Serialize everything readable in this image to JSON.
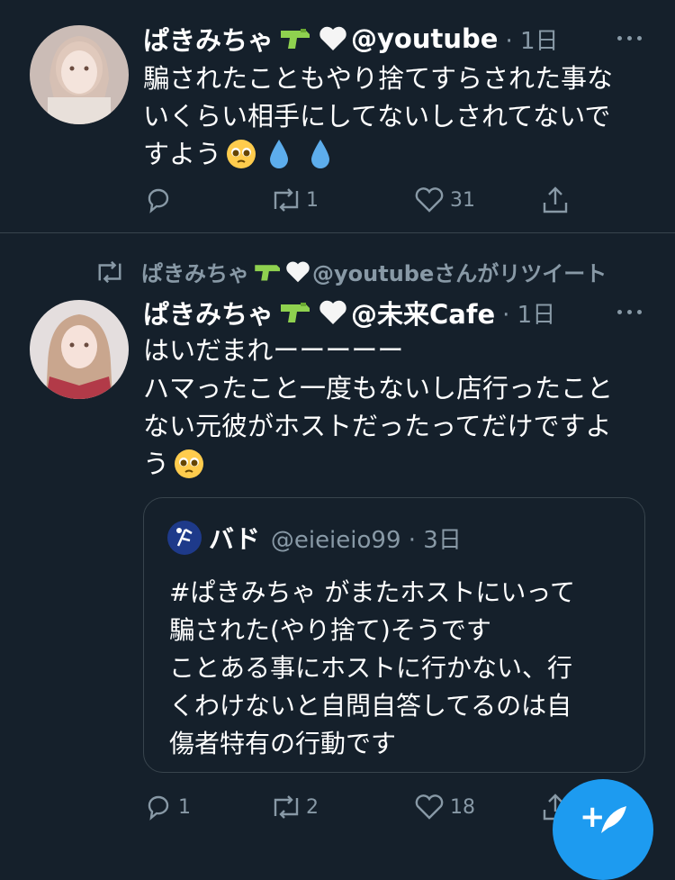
{
  "tweet1": {
    "name": "ぱきみちゃ",
    "handle": "@youtube",
    "time": "· 1日",
    "lines": [
      "騙されたこともやり捨てすらされた事な",
      "いくらい相手にしてないしされてないで",
      "すよう"
    ],
    "reply_count": "",
    "retweet_count": "1",
    "like_count": "31"
  },
  "retweet_banner": "ぱきみちゃ",
  "retweet_banner_suffix": "@youtubeさんがリツイート",
  "tweet2": {
    "name": "ぱきみちゃ",
    "handle": "@未来Cafe",
    "time": "· 1日",
    "lines": [
      "はいだまれーーーーー",
      "ハマったこと一度もないし店行ったこと",
      "ない元彼がホストだったってだけですよ",
      "う"
    ],
    "reply_count": "1",
    "retweet_count": "2",
    "like_count": "18"
  },
  "quote": {
    "name": "バド",
    "handle": "@eieieio99 · 3日",
    "lines": [
      "#ぱきみちゃ がまたホストにいって",
      "騙された(やり捨て)そうです",
      "ことある事にホストに行かない、行",
      "くわけないと自問自答してるのは自",
      "傷者特有の行動です"
    ]
  },
  "fab_label": "+"
}
